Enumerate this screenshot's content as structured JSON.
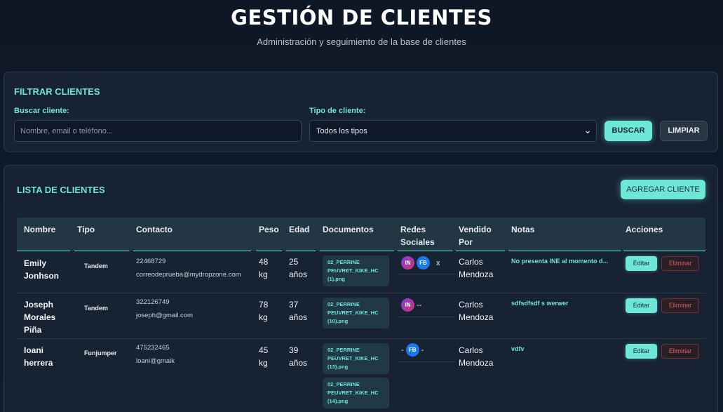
{
  "header": {
    "title": "GESTIÓN DE CLIENTES",
    "subtitle": "Administración y seguimiento de la base de clientes"
  },
  "filter": {
    "title": "FILTRAR CLIENTES",
    "search_label": "Buscar cliente:",
    "search_placeholder": "Nombre, email o teléfono...",
    "type_label": "Tipo de cliente:",
    "type_selected": "Todos los tipos",
    "search_button": "BUSCAR",
    "clear_button": "LIMPIAR"
  },
  "list": {
    "title": "LISTA DE CLIENTES",
    "add_button": "AGREGAR CLIENTE",
    "columns": {
      "nombre": "Nombre",
      "tipo": "Tipo",
      "contacto": "Contacto",
      "peso": "Peso",
      "edad": "Edad",
      "documentos": "Documentos",
      "redes_1": "Redes",
      "redes_2": "Sociales",
      "vendido_1": "Vendido",
      "vendido_2": "Por",
      "notas": "Notas",
      "acciones": "Acciones"
    },
    "rows": [
      {
        "name_1": "Emily",
        "name_2": "Jonhson",
        "name_3": "",
        "tipo": "Tandem",
        "phone": "22468729",
        "email": "correodeprueba@mydropzone.com",
        "peso_num": "48",
        "peso_unit": "kg",
        "edad_num": "25",
        "edad_unit": "años",
        "docs": [
          {
            "l1": "02_PERRINE",
            "l2": "PEUVRET_KIKE_HC",
            "l3": "(1).png"
          }
        ],
        "social_suffix": "x",
        "seller_1": "Carlos",
        "seller_2": "Mendoza",
        "nota": "No presenta INE al momento d...",
        "edit": "Editar",
        "delete": "Eliminar"
      },
      {
        "name_1": "Joseph",
        "name_2": "Morales",
        "name_3": "Piña",
        "tipo": "Tandem",
        "phone": "322126749",
        "email": "joseph@gmail.com",
        "peso_num": "78",
        "peso_unit": "kg",
        "edad_num": "37",
        "edad_unit": "años",
        "docs": [
          {
            "l1": "02_PERRINE",
            "l2": "PEUVRET_KIKE_HC",
            "l3": "(10).png"
          }
        ],
        "social_suffix": "--",
        "seller_1": "Carlos",
        "seller_2": "Mendoza",
        "nota": "sdfsdfsdf s werwer",
        "edit": "Editar",
        "delete": "Eliminar"
      },
      {
        "name_1": "Ioani",
        "name_2": "herrera",
        "name_3": "",
        "tipo": "Funjumper",
        "phone": "475232465",
        "email": "loani@gmaik",
        "peso_num": "45",
        "peso_unit": "kg",
        "edad_num": "39",
        "edad_unit": "años",
        "docs": [
          {
            "l1": "02_PERRINE",
            "l2": "PEUVRET_KIKE_HC",
            "l3": "(13).png"
          },
          {
            "l1": "02_PERRINE",
            "l2": "PEUVRET_KIKE_HC",
            "l3": "(14).png"
          }
        ],
        "social_prefix": "-",
        "social_suffix": "-",
        "seller_1": "Carlos",
        "seller_2": "Mendoza",
        "nota": "vdfv",
        "edit": "Editar",
        "delete": "Eliminar"
      }
    ],
    "social_badges": {
      "instagram": "IN",
      "facebook": "FB"
    }
  },
  "colors": {
    "accent": "#6ee7d8",
    "background": "#0d1726",
    "panel": "#172233",
    "danger": "#e05d5d"
  },
  "icons": {
    "select_arrow": "chevron-down-icon",
    "instagram": "instagram-icon",
    "facebook": "facebook-icon"
  }
}
